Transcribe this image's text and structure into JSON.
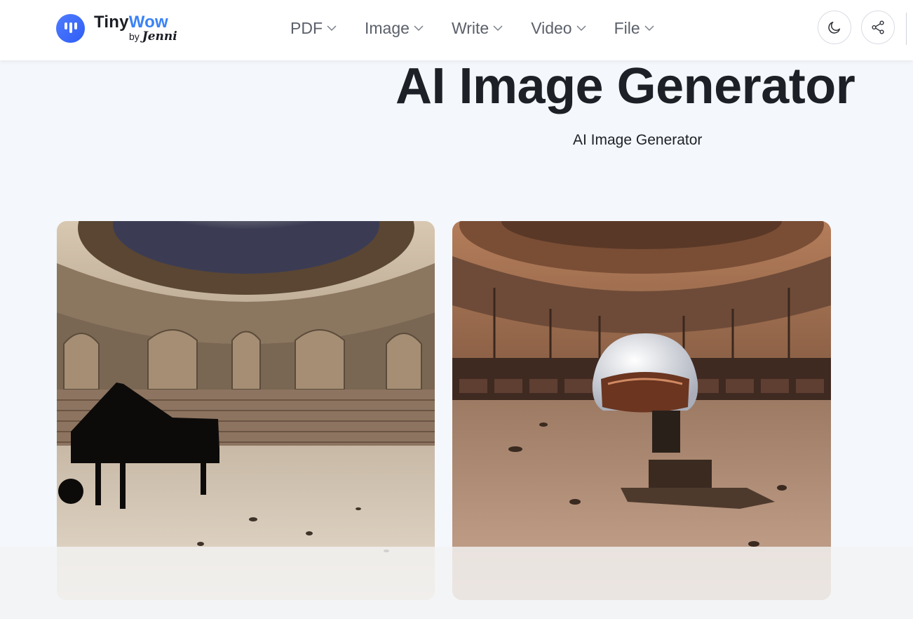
{
  "brand": {
    "name_part1": "Tiny",
    "name_part2": "Wow",
    "by": "by",
    "sub": "Jenni"
  },
  "nav": [
    {
      "label": "PDF"
    },
    {
      "label": "Image"
    },
    {
      "label": "Write"
    },
    {
      "label": "Video"
    },
    {
      "label": "File"
    }
  ],
  "header_actions": {
    "theme_icon": "moon-icon",
    "share_icon": "share-icon"
  },
  "main": {
    "title": "AI Image Generator",
    "subtitle": "AI Image Generator"
  },
  "gallery": [
    {
      "subject": "piano-in-abandoned-concert-hall"
    },
    {
      "subject": "astronaut-helmet-in-abandoned-concert-hall"
    }
  ],
  "colors": {
    "brand_blue": "#3a82f7",
    "text_dark": "#1d2026",
    "nav_text": "#5b606a"
  }
}
